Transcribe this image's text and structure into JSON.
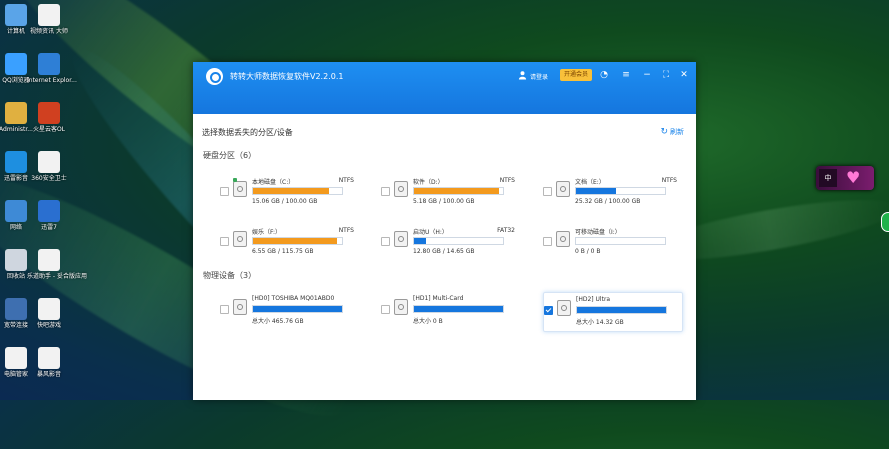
{
  "desktop": {
    "icons": [
      {
        "label": "计算机",
        "color": "#5aa4e8"
      },
      {
        "label": "视频资讯 大师",
        "color": "#f2f2f2"
      },
      {
        "label": "QQ浏览器",
        "color": "#3aa0ff"
      },
      {
        "label": "Internet Explor...",
        "color": "#2e7fd6"
      },
      {
        "label": "Administr...",
        "color": "#e0b040"
      },
      {
        "label": "火星云客OL",
        "color": "#d04020"
      },
      {
        "label": "迅雷影音",
        "color": "#1e8fe0"
      },
      {
        "label": "360安全卫士",
        "color": "#f2f2f2"
      },
      {
        "label": "网络",
        "color": "#3e8ad6"
      },
      {
        "label": "迅雷7",
        "color": "#2a6fd0"
      },
      {
        "label": "回收站",
        "color": "#cfd6df"
      },
      {
        "label": "乐道助手 - 妥合版应用",
        "color": "#f2f2f2"
      },
      {
        "label": "宽带连接",
        "color": "#3e6fb0"
      },
      {
        "label": "快吧游戏",
        "color": "#f2f2f2"
      },
      {
        "label": "电脑管家",
        "color": "#f2f2f2"
      },
      {
        "label": "暴风影音",
        "color": "#f2f2f2"
      }
    ]
  },
  "widget": {
    "square_text": "中",
    "icon": "heart-icon"
  },
  "app": {
    "title": "转转大师数据恢复软件V2.2.0.1",
    "login": "请登录",
    "vip": "开通会员",
    "controls": [
      "history-icon",
      "menu-icon",
      "minimize-icon",
      "maximize-icon",
      "close-icon"
    ],
    "page_title": "选择数据丢失的分区/设备",
    "refresh": "刷新",
    "sections": [
      {
        "title": "硬盘分区（6）",
        "items": [
          {
            "name": "本地磁盘（C:）",
            "fs": "NTFS",
            "size": "15.06 GB / 100.00 GB",
            "usage": 0.85,
            "color": "#f39a1e",
            "checked": false
          },
          {
            "name": "软件（D:）",
            "fs": "NTFS",
            "size": "5.18 GB / 100.00 GB",
            "usage": 0.95,
            "color": "#f39a1e",
            "checked": false
          },
          {
            "name": "文档（E:）",
            "fs": "NTFS",
            "size": "25.32 GB / 100.00 GB",
            "usage": 0.45,
            "color": "#1576de",
            "checked": false
          },
          {
            "name": "娱乐（F:）",
            "fs": "NTFS",
            "size": "6.55 GB / 115.75 GB",
            "usage": 0.94,
            "color": "#f39a1e",
            "checked": false
          },
          {
            "name": "启动U（H:）",
            "fs": "FAT32",
            "size": "12.80 GB / 14.65 GB",
            "usage": 0.13,
            "color": "#1576de",
            "checked": false
          },
          {
            "name": "可移动磁盘（I:）",
            "fs": "",
            "size": "0 B / 0 B",
            "usage": 0,
            "color": "#1576de",
            "checked": false
          }
        ]
      },
      {
        "title": "物理设备（3）",
        "items": [
          {
            "name": "[HD0] TOSHIBA MQ01ABD0",
            "fs": "",
            "size": "总大小 465.76 GB",
            "usage": 1,
            "color": "#1576de",
            "checked": false
          },
          {
            "name": "[HD1] Multi-Card",
            "fs": "",
            "size": "总大小 0 B",
            "usage": 1,
            "color": "#1576de",
            "checked": false
          },
          {
            "name": "[HD2] Ultra",
            "fs": "",
            "size": "总大小 14.32 GB",
            "usage": 1,
            "color": "#1576de",
            "checked": true
          }
        ]
      }
    ]
  }
}
